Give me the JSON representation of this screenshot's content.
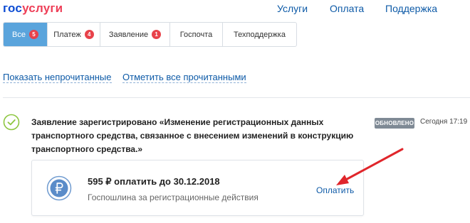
{
  "header": {
    "logo_part1": "гос",
    "logo_part2": "услуги",
    "nav": [
      "Услуги",
      "Оплата",
      "Поддержка"
    ]
  },
  "tabs": [
    {
      "label": "Все",
      "count": "5"
    },
    {
      "label": "Платеж",
      "count": "4"
    },
    {
      "label": "Заявление",
      "count": "1"
    },
    {
      "label": "Госпочта",
      "count": ""
    },
    {
      "label": "Техподдержка",
      "count": ""
    }
  ],
  "filters": {
    "show_unread": "Показать непрочитанные",
    "mark_all_read": "Отметить все прочитанными"
  },
  "notification": {
    "text": "Заявление зарегистрировано «Изменение регистрационных данных транспортного средства, связанное с внесением изменений в конструкцию транспортного средства.»",
    "status": "ОБНОВЛЕНО",
    "time": "Сегодня 17:19",
    "payment": {
      "amount_line": "595 ₽ оплатить до 30.12.2018",
      "description": "Госпошлина за регистрационные действия",
      "pay_label": "Оплатить"
    }
  },
  "colors": {
    "link": "#0d5aa7",
    "active_tab": "#5aa4dc",
    "badge": "#e8424a",
    "status_badge": "#7f8a95",
    "check": "#8dc63f",
    "arrow": "#e0262b"
  },
  "icons": [
    "check-circle-icon",
    "ruble-icon",
    "red-arrow"
  ]
}
